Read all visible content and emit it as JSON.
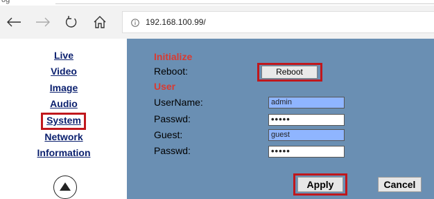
{
  "browser": {
    "top_label": "og",
    "url": "192.168.100.99/"
  },
  "sidebar": {
    "items": [
      {
        "label": "Live"
      },
      {
        "label": "Video"
      },
      {
        "label": "Image"
      },
      {
        "label": "Audio"
      },
      {
        "label": "System"
      },
      {
        "label": "Network"
      },
      {
        "label": "Information"
      }
    ],
    "highlighted": "System",
    "scroll_up_icon": "triangle-up-circle-icon"
  },
  "form": {
    "initialize_heading": "Initialize",
    "reboot_label": "Reboot:",
    "reboot_button": "Reboot",
    "user_heading": "User",
    "username_label": "UserName:",
    "username_value": "admin",
    "passwd_label": "Passwd:",
    "passwd_value": "•••••",
    "guest_label": "Guest:",
    "guest_value": "guest",
    "guest_passwd_label": "Passwd:",
    "guest_passwd_value": "•••••"
  },
  "actions": {
    "apply": "Apply",
    "cancel": "Cancel"
  },
  "colors": {
    "panel": "#6a8fb3",
    "section_heading": "#d93a30",
    "highlight_box": "#c0171c",
    "link": "#0a1f6e",
    "input_blue": "#8fb5ff"
  }
}
